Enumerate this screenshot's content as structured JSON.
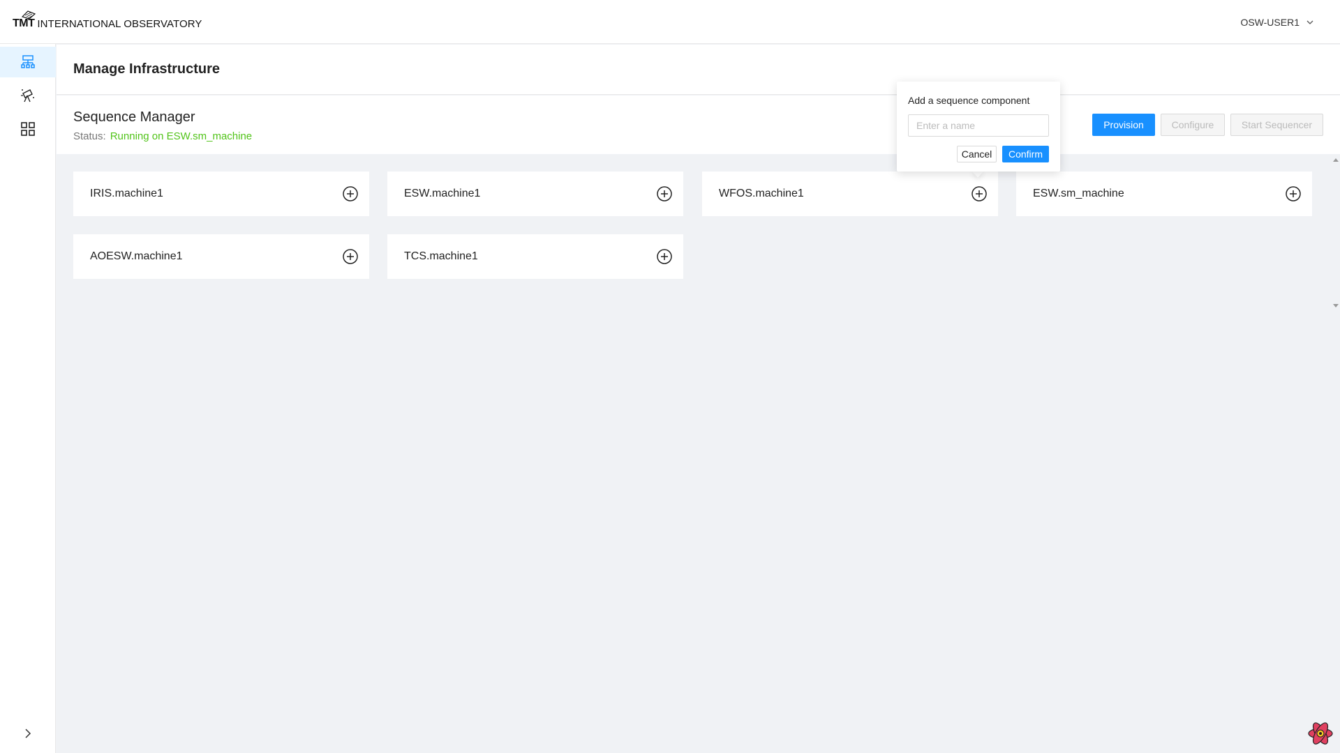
{
  "header": {
    "logo_mark": "TMT",
    "logo_text": "INTERNATIONAL OBSERVATORY",
    "user_name": "OSW-USER1",
    "user_icon": "chevron-down-icon"
  },
  "sidebar": {
    "items": [
      {
        "icon": "infrastructure-icon",
        "active": true
      },
      {
        "icon": "telescope-icon",
        "active": false
      },
      {
        "icon": "grid-icon",
        "active": false
      }
    ],
    "collapse_icon": "chevron-right-icon"
  },
  "page": {
    "title": "Manage Infrastructure"
  },
  "sequence_manager": {
    "title": "Sequence Manager",
    "status_label": "Status:",
    "status_value": "Running on ESW.sm_machine",
    "status_color": "#52c41a",
    "buttons": {
      "provision": "Provision",
      "configure": "Configure",
      "start_sequencer": "Start Sequencer"
    }
  },
  "machines": [
    {
      "name": "IRIS.machine1"
    },
    {
      "name": "ESW.machine1"
    },
    {
      "name": "WFOS.machine1"
    },
    {
      "name": "ESW.sm_machine"
    },
    {
      "name": "AOESW.machine1"
    },
    {
      "name": "TCS.machine1"
    }
  ],
  "popover": {
    "title": "Add a sequence component",
    "input_placeholder": "Enter a name",
    "input_value": "",
    "cancel_label": "Cancel",
    "confirm_label": "Confirm"
  },
  "colors": {
    "primary": "#1890ff",
    "background": "#f0f2f5",
    "active_nav": "#e6f4ff",
    "status_ok": "#52c41a"
  }
}
